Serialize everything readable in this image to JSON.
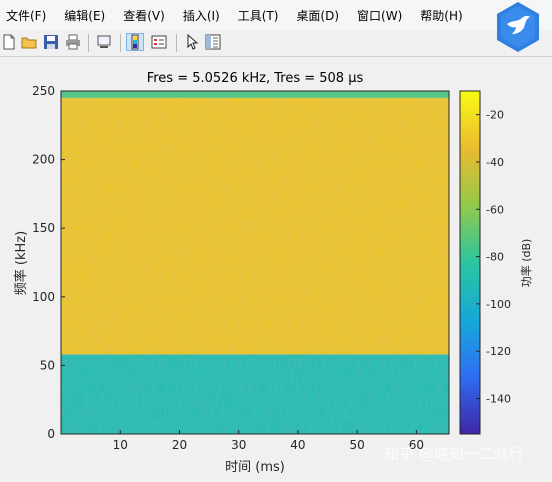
{
  "menu": {
    "items": [
      "文件(F)",
      "编辑(E)",
      "查看(V)",
      "插入(I)",
      "工具(T)",
      "桌面(D)",
      "窗口(W)",
      "帮助(H)"
    ]
  },
  "toolbar": {
    "icons": [
      "new-file-icon",
      "open-folder-icon",
      "save-icon",
      "print-icon",
      "link-plot-icon",
      "colorbar-icon",
      "legend-icon",
      "pointer-icon",
      "property-editor-icon"
    ]
  },
  "colors": {
    "high_power": "#f5c028",
    "low_power": "#2bb6c4",
    "colormap": [
      "#3e26a8",
      "#2e6ef4",
      "#16a8d9",
      "#2bc59f",
      "#95c949",
      "#eaba30",
      "#f9fb15"
    ]
  },
  "chart_data": {
    "type": "heatmap",
    "title": "Fres = 5.0526 kHz, Tres = 508 µs",
    "xlabel": "时间 (ms)",
    "ylabel": "频率 (kHz)",
    "xlim": [
      0,
      65.5
    ],
    "ylim": [
      0,
      250
    ],
    "xticks": [
      10,
      20,
      30,
      40,
      50,
      60
    ],
    "yticks": [
      0,
      50,
      100,
      150,
      200,
      250
    ],
    "bands": [
      {
        "freq_range_khz": [
          0,
          58
        ],
        "power_db": -90
      },
      {
        "freq_range_khz": [
          58,
          245
        ],
        "power_db": -30
      },
      {
        "freq_range_khz": [
          245,
          250
        ],
        "power_db": -75
      }
    ],
    "colorbar": {
      "label": "功率 (dB)",
      "range": [
        -155,
        -10
      ],
      "ticks": [
        -20,
        -40,
        -60,
        -80,
        -100,
        -120,
        -140
      ]
    }
  },
  "watermark": "知乎 @略知一二就行"
}
